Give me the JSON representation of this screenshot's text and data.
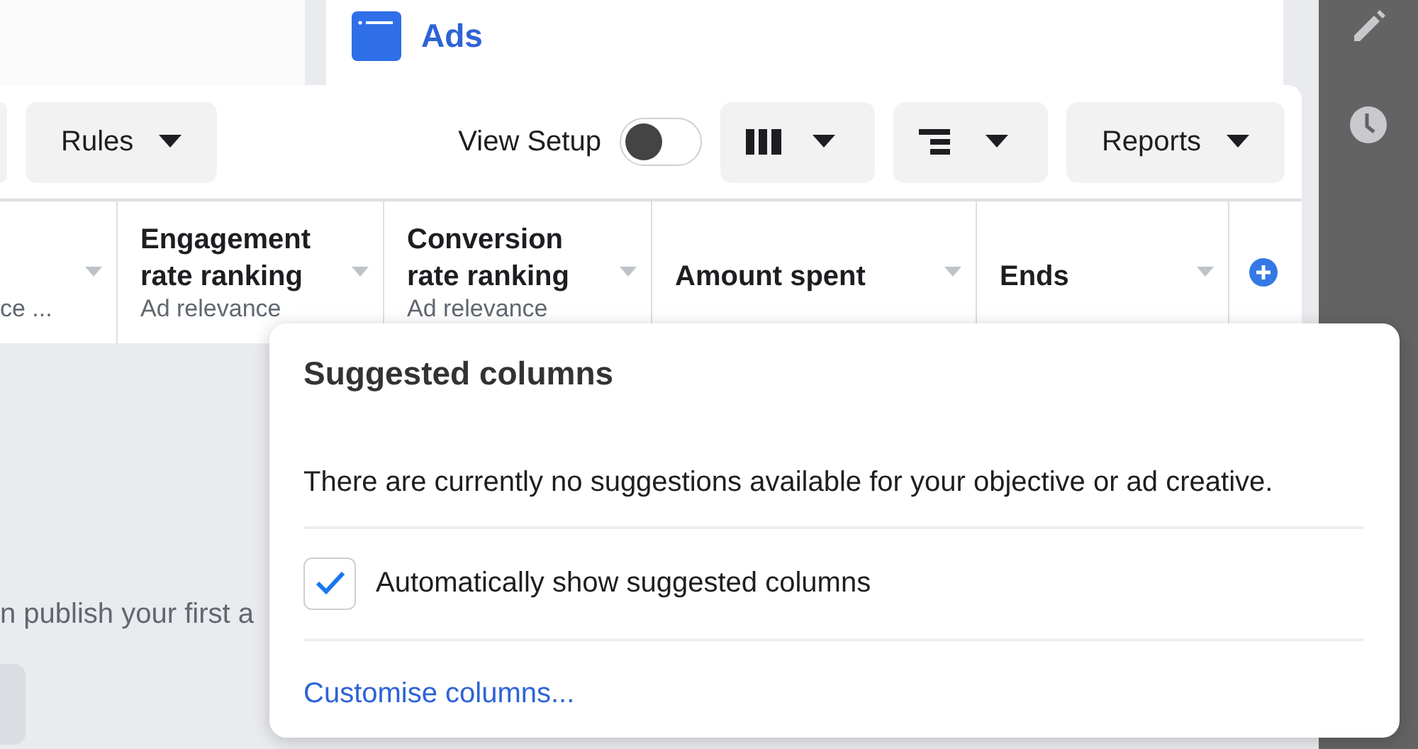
{
  "header": {
    "title": "Ads"
  },
  "toolbar": {
    "rules": {
      "label": "Rules"
    },
    "view_setup": {
      "label": "View Setup",
      "on": false
    },
    "icon_buttons": [
      {
        "kind": "columns"
      },
      {
        "kind": "breakdown"
      }
    ],
    "reports": {
      "label": "Reports"
    }
  },
  "table": {
    "columns": [
      {
        "subtitle": "ce ..."
      },
      {
        "title": "Engagement rate ranking",
        "subtitle": "Ad relevance"
      },
      {
        "title": "Conversion rate ranking",
        "subtitle": "Ad relevance"
      },
      {
        "title": "Amount spent"
      },
      {
        "title": "Ends"
      }
    ]
  },
  "background_text": "n publish your first a",
  "popup": {
    "title": "Suggested columns",
    "message": "There are currently no suggestions available for your objective or ad creative.",
    "auto_show": {
      "label": "Automatically show suggested columns",
      "checked": true
    },
    "link": "Customise columns..."
  }
}
